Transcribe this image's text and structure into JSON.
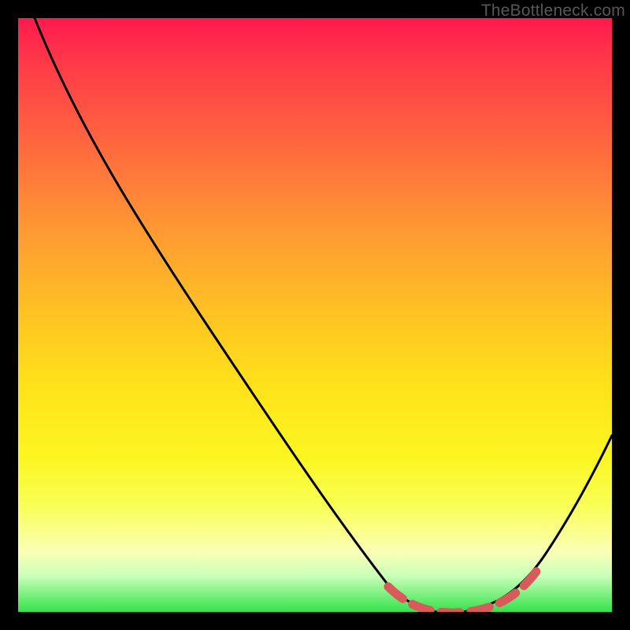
{
  "watermark": "TheBottleneck.com",
  "chart_data": {
    "type": "line",
    "title": "",
    "xlabel": "",
    "ylabel": "",
    "xlim": [
      0,
      100
    ],
    "ylim": [
      0,
      100
    ],
    "grid": false,
    "series": [
      {
        "name": "bottleneck-curve",
        "x": [
          3,
          10,
          20,
          30,
          40,
          50,
          60,
          68,
          73,
          78,
          83,
          88,
          92,
          96,
          100
        ],
        "y": [
          100,
          89,
          74,
          59,
          44,
          29,
          14,
          2,
          0.5,
          0.5,
          2,
          6,
          13,
          21,
          30
        ]
      }
    ],
    "annotation": {
      "name": "optimal-range-dashed",
      "x_range": [
        63,
        87
      ],
      "y": 0.8,
      "style": "dashed"
    },
    "gradient_stops": [
      {
        "pos": 0,
        "color": "#ff1a4d"
      },
      {
        "pos": 50,
        "color": "#ffc323"
      },
      {
        "pos": 74,
        "color": "#fbf622"
      },
      {
        "pos": 94,
        "color": "#c8ffb8"
      },
      {
        "pos": 100,
        "color": "#33e24a"
      }
    ]
  }
}
